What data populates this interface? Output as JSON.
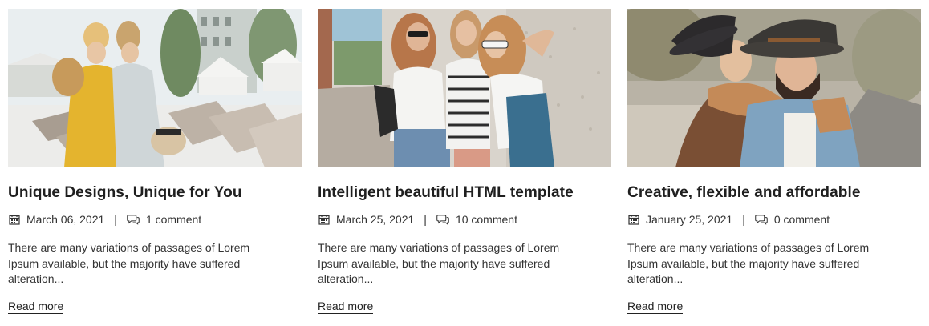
{
  "posts": [
    {
      "title": "Unique Designs, Unique for You",
      "date": "March 06, 2021",
      "separator": "|",
      "comments": "1 comment",
      "excerpt": "There are many variations of passages of Lorem Ipsum available, but the majority have suffered alteration...",
      "read_more": "Read more",
      "image_icon": "beach-resort-photo"
    },
    {
      "title": "Intelligent beautiful HTML template",
      "date": "March 25, 2021",
      "separator": "|",
      "comments": "10 comment",
      "excerpt": "There are many variations of passages of Lorem Ipsum available, but the majority have suffered alteration...",
      "read_more": "Read more",
      "image_icon": "street-friends-photo"
    },
    {
      "title": "Creative, flexible and affordable",
      "date": "January 25, 2021",
      "separator": "|",
      "comments": "0 comment",
      "excerpt": "There are many variations of passages of Lorem Ipsum available, but the majority have suffered alteration...",
      "read_more": "Read more",
      "image_icon": "couple-hats-photo"
    }
  ],
  "icons": {
    "date": "calendar-icon",
    "comments": "comment-bubble-icon"
  },
  "colors": {
    "text": "#222222",
    "title": "#1f1f1f",
    "background": "#ffffff"
  }
}
